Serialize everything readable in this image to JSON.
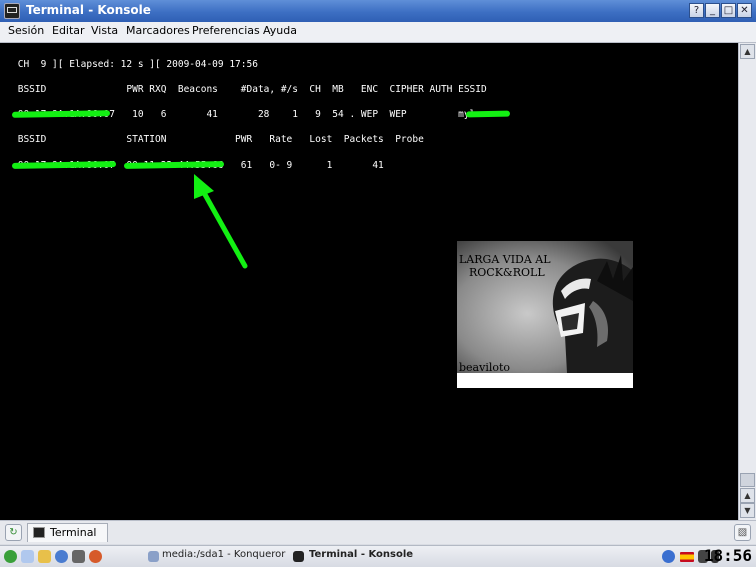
{
  "window": {
    "title": "Terminal - Konsole",
    "buttons": {
      "help": "?",
      "minimize": "_",
      "maximize": "□",
      "close": "✕"
    }
  },
  "menu": [
    "Sesión",
    "Editar",
    "Vista",
    "Marcadores",
    "Preferencias",
    "Ayuda"
  ],
  "terminal": {
    "status_line": " CH  9 ][ Elapsed: 12 s ][ 2009-04-09 17:56",
    "ap_header": " BSSID              PWR RXQ  Beacons    #Data, #/s  CH  MB   ENC  CIPHER AUTH ESSID",
    "ap_row": " 00:17:9A:1A:86:07   10   6       41       28    1   9  54 . WEP  WEP         mylan",
    "station_header": " BSSID              STATION            PWR   Rate   Lost  Packets  Probe",
    "station_row": " 00:17:9A:1A:86:07  00:11:22:44:55:66   61   0- 9      1       41"
  },
  "banner": {
    "line1": "LARGA VIDA AL",
    "line2": "ROCK&ROLL",
    "signature": "beaviloto"
  },
  "tabs": [
    {
      "label": "Terminal",
      "icon": "terminal-icon"
    }
  ],
  "taskbar": {
    "tasks": [
      "media:/sda1 - Konqueror",
      "Terminal - Konsole"
    ],
    "clock": "18:56"
  },
  "colors": {
    "titlebar": "#3d6fc3",
    "highlight": "#13f013",
    "terminal_bg": "#000000"
  }
}
